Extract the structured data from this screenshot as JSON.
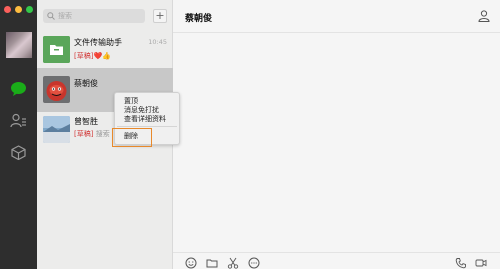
{
  "sidebar": {
    "icons": [
      "chat-icon",
      "contacts-icon",
      "favorites-icon"
    ],
    "accent": "#1aad19"
  },
  "search": {
    "placeholder": "搜索"
  },
  "chats": [
    {
      "name": "文件传输助手",
      "time": "10:45",
      "draft_label": "[草稿]",
      "preview": "❤️👍"
    },
    {
      "name": "蔡朝俊",
      "time": "",
      "draft_label": "",
      "preview": ""
    },
    {
      "name": "曾智胜",
      "time": "",
      "draft_label": "[草稿]",
      "preview": "搜索"
    }
  ],
  "context_menu": {
    "items": [
      "置顶",
      "消息免打扰",
      "查看详细资料",
      "删除"
    ]
  },
  "conversation": {
    "title": "蔡朝俊"
  },
  "colors": {
    "highlight": "#e8892b",
    "draft": "#d23b3b"
  }
}
